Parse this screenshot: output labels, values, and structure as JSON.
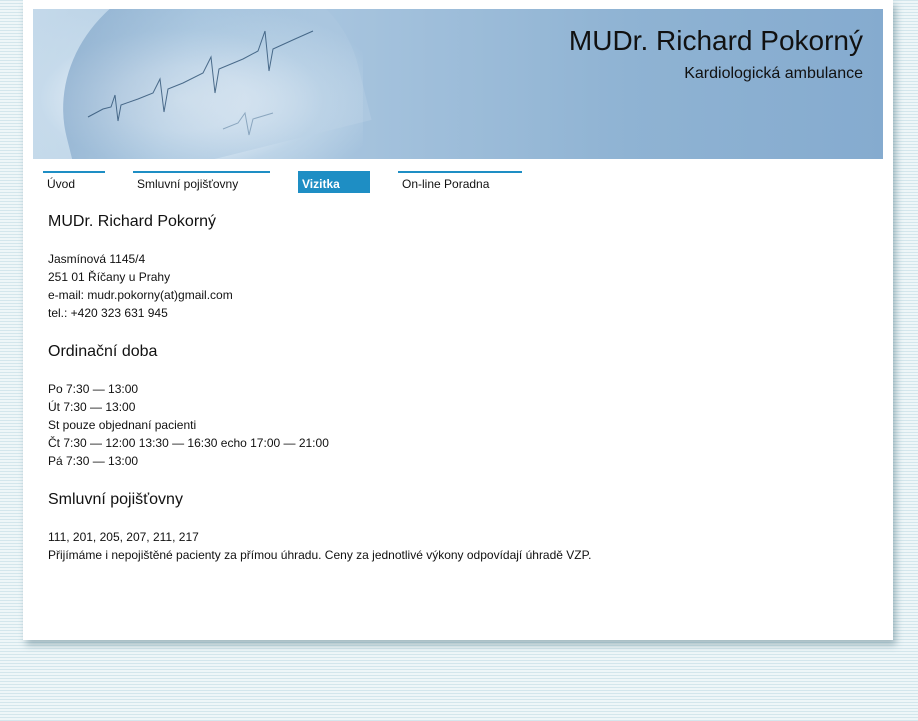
{
  "header": {
    "title": "MUDr. Richard Pokorný",
    "subtitle": "Kardiologická ambulance"
  },
  "nav": {
    "items": [
      {
        "label": "Úvod",
        "active": false
      },
      {
        "label": "Smluvní pojišťovny",
        "active": false
      },
      {
        "label": "Vizitka",
        "active": true
      },
      {
        "label": "On-line Poradna",
        "active": false
      }
    ]
  },
  "content": {
    "contact": {
      "heading": "MUDr. Richard Pokorný",
      "lines": [
        "Jasmínová 1145/4",
        "251 01 Říčany u Prahy",
        "e-mail: mudr.pokorny(at)gmail.com",
        "tel.: +420 323 631 945"
      ]
    },
    "hours": {
      "heading": "Ordinační doba",
      "lines": [
        "Po 7:30 — 13:00",
        "Út 7:30 — 13:00",
        "St pouze objednaní pacienti",
        "Čt 7:30 — 12:00 13:30 — 16:30 echo 17:00 — 21:00",
        "Pá 7:30 — 13:00"
      ]
    },
    "insurance": {
      "heading": "Smluvní pojišťovny",
      "lines": [
        "111, 201, 205, 207, 211, 217",
        "Přijímáme i nepojištěné pacienty za přímou úhradu. Ceny za jednotlivé výkony odpovídají úhradě VZP."
      ]
    }
  },
  "colors": {
    "accent": "#1e8ec4",
    "header_gradient_start": "#c4d9ea",
    "header_gradient_end": "#85abcf"
  }
}
